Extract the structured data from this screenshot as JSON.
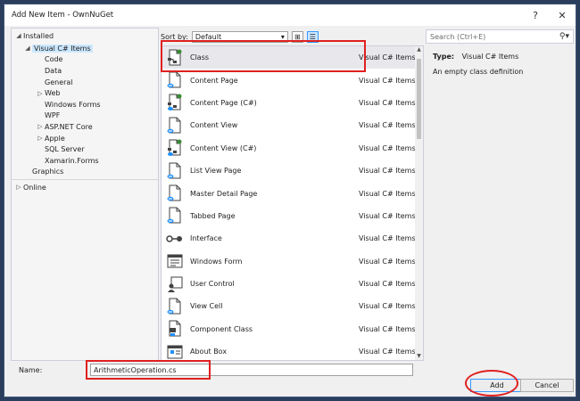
{
  "window": {
    "title": "Add New Item - OwnNuGet",
    "help_glyph": "?",
    "close_glyph": "✕"
  },
  "tree": {
    "installed_label": "Installed",
    "items": [
      {
        "label": "Visual C# Items",
        "level": 1,
        "arrow": "◢",
        "selected": true
      },
      {
        "label": "Code",
        "level": 2,
        "arrow": ""
      },
      {
        "label": "Data",
        "level": 2,
        "arrow": ""
      },
      {
        "label": "General",
        "level": 2,
        "arrow": ""
      },
      {
        "label": "Web",
        "level": 2,
        "arrow": "▷"
      },
      {
        "label": "Windows Forms",
        "level": 2,
        "arrow": ""
      },
      {
        "label": "WPF",
        "level": 2,
        "arrow": ""
      },
      {
        "label": "ASP.NET Core",
        "level": 2,
        "arrow": "▷"
      },
      {
        "label": "Apple",
        "level": 2,
        "arrow": "▷"
      },
      {
        "label": "SQL Server",
        "level": 2,
        "arrow": ""
      },
      {
        "label": "Xamarin.Forms",
        "level": 2,
        "arrow": ""
      },
      {
        "label": "Graphics",
        "level": 1,
        "arrow": ""
      }
    ],
    "online_label": "Online"
  },
  "toolbar": {
    "sort_label": "Sort by:",
    "sort_value": "Default"
  },
  "templates": [
    {
      "name": "Class",
      "category": "Visual C# Items",
      "icon": "class-file-icon",
      "selected": true
    },
    {
      "name": "Content Page",
      "category": "Visual C# Items",
      "icon": "xaml-page-icon"
    },
    {
      "name": "Content Page (C#)",
      "category": "Visual C# Items",
      "icon": "cs-page-icon"
    },
    {
      "name": "Content View",
      "category": "Visual C# Items",
      "icon": "xaml-page-icon"
    },
    {
      "name": "Content View (C#)",
      "category": "Visual C# Items",
      "icon": "cs-page-icon"
    },
    {
      "name": "List View Page",
      "category": "Visual C# Items",
      "icon": "xaml-page-icon"
    },
    {
      "name": "Master Detail Page",
      "category": "Visual C# Items",
      "icon": "xaml-page-icon"
    },
    {
      "name": "Tabbed Page",
      "category": "Visual C# Items",
      "icon": "xaml-page-icon"
    },
    {
      "name": "Interface",
      "category": "Visual C# Items",
      "icon": "interface-icon"
    },
    {
      "name": "Windows Form",
      "category": "Visual C# Items",
      "icon": "windows-form-icon"
    },
    {
      "name": "User Control",
      "category": "Visual C# Items",
      "icon": "user-control-icon"
    },
    {
      "name": "View Cell",
      "category": "Visual C# Items",
      "icon": "xaml-page-icon"
    },
    {
      "name": "Component Class",
      "category": "Visual C# Items",
      "icon": "component-class-icon"
    },
    {
      "name": "About Box",
      "category": "Visual C# Items",
      "icon": "about-box-icon"
    }
  ],
  "search": {
    "placeholder": "Search (Ctrl+E)"
  },
  "details": {
    "type_key": "Type:",
    "type_value": "Visual C# Items",
    "description": "An empty class definition"
  },
  "bottom": {
    "name_label": "Name:",
    "name_value": "ArithmeticOperation.cs",
    "add_label": "Add",
    "cancel_label": "Cancel"
  },
  "colors": {
    "highlight": "#e02020",
    "accent": "#3399ff",
    "selection": "#cce8ff"
  }
}
